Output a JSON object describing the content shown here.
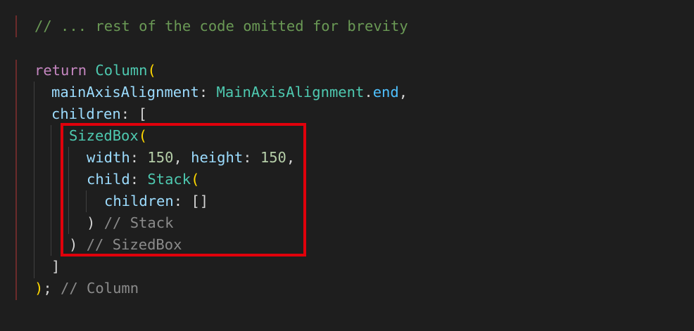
{
  "code": {
    "line1": {
      "comment": "// ... rest of the code omitted for brevity"
    },
    "line2": {
      "keyword": "return",
      "class": "Column",
      "paren": "("
    },
    "line3": {
      "prop": "mainAxisAlignment",
      "colon": ":",
      "class": "MainAxisAlignment",
      "dot": ".",
      "member": "end",
      "comma": ","
    },
    "line4": {
      "prop": "children",
      "colon": ":",
      "bracket": "["
    },
    "line5": {
      "class": "SizedBox",
      "paren": "("
    },
    "line6": {
      "prop1": "width",
      "colon1": ":",
      "num1": "150",
      "comma1": ",",
      "prop2": "height",
      "colon2": ":",
      "num2": "150",
      "comma2": ","
    },
    "line7": {
      "prop": "child",
      "colon": ":",
      "class": "Stack",
      "paren": "("
    },
    "line8": {
      "prop": "children",
      "colon": ":",
      "brackets": "[]"
    },
    "line9": {
      "paren": ")",
      "comment": "// Stack"
    },
    "line10": {
      "paren": ")",
      "comment": "// SizedBox"
    },
    "line11": {
      "bracket": "]"
    },
    "line12": {
      "paren": ")",
      "semicolon": ";",
      "comment": "// Column"
    }
  },
  "colors": {
    "background": "#1e1e1e",
    "keyword": "#c586c0",
    "class": "#4ec9b0",
    "property": "#9cdcfe",
    "number": "#b5cea8",
    "comment": "#6a9955",
    "highlight": "#e0000b"
  }
}
